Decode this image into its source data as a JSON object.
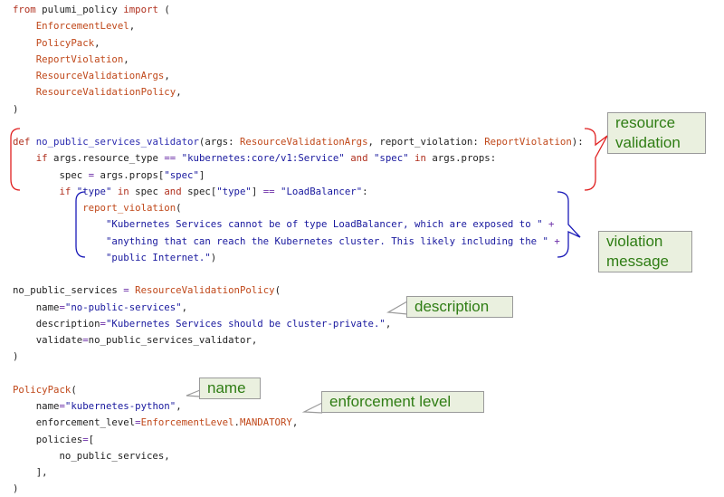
{
  "code_lines": [
    [
      {
        "t": "kw",
        "v": "from"
      },
      {
        "t": "",
        "v": " pulumi_policy "
      },
      {
        "t": "kw",
        "v": "import"
      },
      {
        "t": "",
        "v": " ("
      }
    ],
    [
      {
        "t": "",
        "v": "    "
      },
      {
        "t": "cls",
        "v": "EnforcementLevel"
      },
      {
        "t": "",
        "v": ","
      }
    ],
    [
      {
        "t": "",
        "v": "    "
      },
      {
        "t": "cls",
        "v": "PolicyPack"
      },
      {
        "t": "",
        "v": ","
      }
    ],
    [
      {
        "t": "",
        "v": "    "
      },
      {
        "t": "cls",
        "v": "ReportViolation"
      },
      {
        "t": "",
        "v": ","
      }
    ],
    [
      {
        "t": "",
        "v": "    "
      },
      {
        "t": "cls",
        "v": "ResourceValidationArgs"
      },
      {
        "t": "",
        "v": ","
      }
    ],
    [
      {
        "t": "",
        "v": "    "
      },
      {
        "t": "cls",
        "v": "ResourceValidationPolicy"
      },
      {
        "t": "",
        "v": ","
      }
    ],
    [
      {
        "t": "",
        "v": ")"
      }
    ],
    [],
    [
      {
        "t": "def",
        "v": "def"
      },
      {
        "t": "",
        "v": " "
      },
      {
        "t": "fn",
        "v": "no_public_services_validator"
      },
      {
        "t": "",
        "v": "(args: "
      },
      {
        "t": "cls",
        "v": "ResourceValidationArgs"
      },
      {
        "t": "",
        "v": ", report_violation: "
      },
      {
        "t": "cls",
        "v": "ReportViolation"
      },
      {
        "t": "",
        "v": "):"
      }
    ],
    [
      {
        "t": "",
        "v": "    "
      },
      {
        "t": "kw",
        "v": "if"
      },
      {
        "t": "",
        "v": " args.resource_type "
      },
      {
        "t": "op",
        "v": "=="
      },
      {
        "t": "",
        "v": " "
      },
      {
        "t": "str",
        "v": "\"kubernetes:core/v1:Service\""
      },
      {
        "t": "",
        "v": " "
      },
      {
        "t": "kw",
        "v": "and"
      },
      {
        "t": "",
        "v": " "
      },
      {
        "t": "str",
        "v": "\"spec\""
      },
      {
        "t": "",
        "v": " "
      },
      {
        "t": "kw",
        "v": "in"
      },
      {
        "t": "",
        "v": " args.props:"
      }
    ],
    [
      {
        "t": "",
        "v": "        spec "
      },
      {
        "t": "op",
        "v": "="
      },
      {
        "t": "",
        "v": " args.props["
      },
      {
        "t": "str",
        "v": "\"spec\""
      },
      {
        "t": "",
        "v": "]"
      }
    ],
    [
      {
        "t": "",
        "v": "        "
      },
      {
        "t": "kw",
        "v": "if"
      },
      {
        "t": "",
        "v": " "
      },
      {
        "t": "str",
        "v": "\"type\""
      },
      {
        "t": "",
        "v": " "
      },
      {
        "t": "kw",
        "v": "in"
      },
      {
        "t": "",
        "v": " spec "
      },
      {
        "t": "kw",
        "v": "and"
      },
      {
        "t": "",
        "v": " spec["
      },
      {
        "t": "str",
        "v": "\"type\""
      },
      {
        "t": "",
        "v": "] "
      },
      {
        "t": "op",
        "v": "=="
      },
      {
        "t": "",
        "v": " "
      },
      {
        "t": "str",
        "v": "\"LoadBalancer\""
      },
      {
        "t": "",
        "v": ":"
      }
    ],
    [
      {
        "t": "",
        "v": "            "
      },
      {
        "t": "cls",
        "v": "report_violation"
      },
      {
        "t": "",
        "v": "("
      }
    ],
    [
      {
        "t": "",
        "v": "                "
      },
      {
        "t": "str",
        "v": "\"Kubernetes Services cannot be of type LoadBalancer, which are exposed to \""
      },
      {
        "t": "",
        "v": " "
      },
      {
        "t": "op",
        "v": "+"
      }
    ],
    [
      {
        "t": "",
        "v": "                "
      },
      {
        "t": "str",
        "v": "\"anything that can reach the Kubernetes cluster. This likely including the \""
      },
      {
        "t": "",
        "v": " "
      },
      {
        "t": "op",
        "v": "+"
      }
    ],
    [
      {
        "t": "",
        "v": "                "
      },
      {
        "t": "str",
        "v": "\"public Internet.\""
      },
      {
        "t": "",
        "v": ")"
      }
    ],
    [],
    [
      {
        "t": "",
        "v": "no_public_services "
      },
      {
        "t": "op",
        "v": "="
      },
      {
        "t": "",
        "v": " "
      },
      {
        "t": "cls",
        "v": "ResourceValidationPolicy"
      },
      {
        "t": "",
        "v": "("
      }
    ],
    [
      {
        "t": "",
        "v": "    name"
      },
      {
        "t": "op",
        "v": "="
      },
      {
        "t": "str",
        "v": "\"no-public-services\""
      },
      {
        "t": "",
        "v": ","
      }
    ],
    [
      {
        "t": "",
        "v": "    description"
      },
      {
        "t": "op",
        "v": "="
      },
      {
        "t": "str",
        "v": "\"Kubernetes Services should be cluster-private.\""
      },
      {
        "t": "",
        "v": ","
      }
    ],
    [
      {
        "t": "",
        "v": "    validate"
      },
      {
        "t": "op",
        "v": "="
      },
      {
        "t": "",
        "v": "no_public_services_validator,"
      }
    ],
    [
      {
        "t": "",
        "v": ")"
      }
    ],
    [],
    [
      {
        "t": "cls",
        "v": "PolicyPack"
      },
      {
        "t": "",
        "v": "("
      }
    ],
    [
      {
        "t": "",
        "v": "    name"
      },
      {
        "t": "op",
        "v": "="
      },
      {
        "t": "str",
        "v": "\"kubernetes-python\""
      },
      {
        "t": "",
        "v": ","
      }
    ],
    [
      {
        "t": "",
        "v": "    enforcement_level"
      },
      {
        "t": "op",
        "v": "="
      },
      {
        "t": "cls",
        "v": "EnforcementLevel"
      },
      {
        "t": "",
        "v": "."
      },
      {
        "t": "cls",
        "v": "MANDATORY"
      },
      {
        "t": "",
        "v": ","
      }
    ],
    [
      {
        "t": "",
        "v": "    policies"
      },
      {
        "t": "op",
        "v": "="
      },
      {
        "t": "",
        "v": "["
      }
    ],
    [
      {
        "t": "",
        "v": "        no_public_services,"
      }
    ],
    [
      {
        "t": "",
        "v": "    ],"
      }
    ],
    [
      {
        "t": "",
        "v": ")"
      }
    ]
  ],
  "annotations": {
    "resource_validation": "resource\nvalidation",
    "violation_message": "violation\nmessage",
    "description": "description",
    "name": "name",
    "enforcement_level": "enforcement level"
  },
  "colors": {
    "keyword": "#b0301e",
    "function": "#2b2bb0",
    "class": "#c0481a",
    "string": "#18189e",
    "operator": "#6c2fa8",
    "callout_bg": "#eaf0df",
    "callout_text": "#2f7d14",
    "bracket": "#e02020",
    "bracket_blue": "#1a1ab8"
  }
}
